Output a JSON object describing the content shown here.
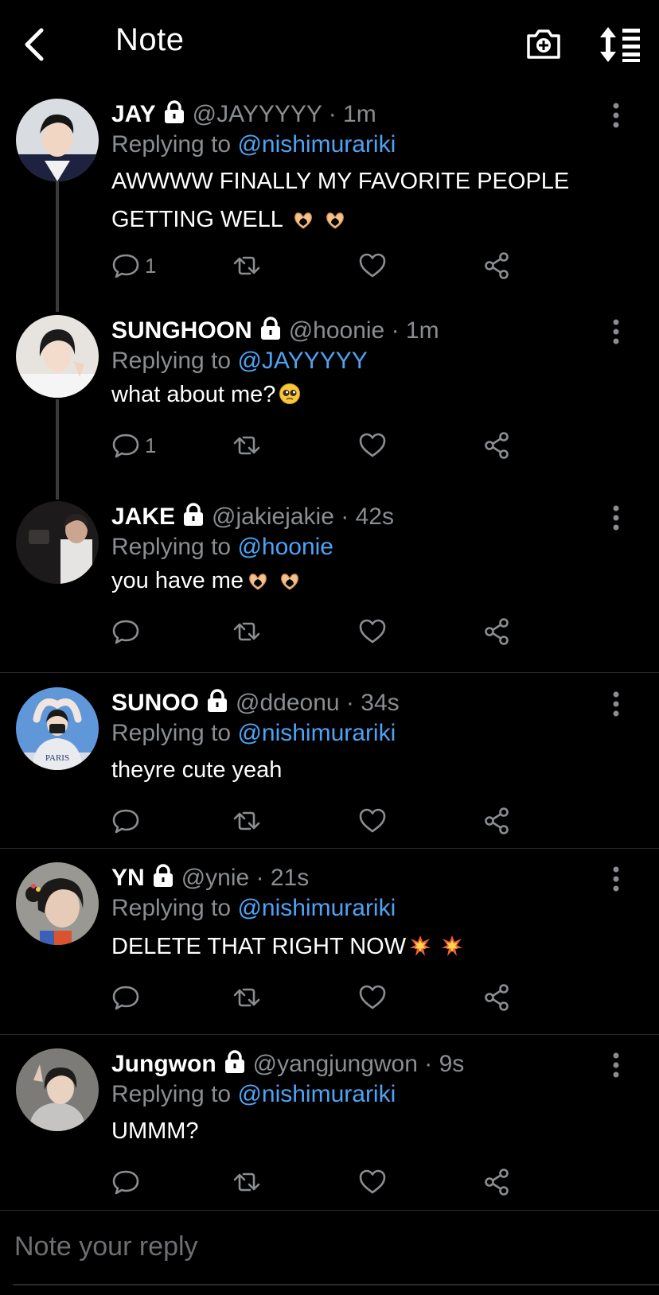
{
  "header": {
    "title": "Note",
    "back_icon": "chevron-left-icon",
    "camera_icon": "camera-plus-icon",
    "sort_icon": "sort-list-icon"
  },
  "colors": {
    "background": "#000000",
    "mention": "#4ea3f5",
    "muted": "#8a8d91"
  },
  "posts": [
    {
      "name": "JAY",
      "handle": "@JAYYYYY",
      "dot": "·",
      "time": "1m",
      "replying_label": "Replying to",
      "replying_to": "@nishimurariki",
      "text_lines": [
        "AWWWW FINALLY MY FAVORITE PEOPLE",
        "GETTING WELL"
      ],
      "reply_count": "1",
      "emoji": "heart-hands"
    },
    {
      "name": "SUNGHOON",
      "handle": "@hoonie",
      "dot": "·",
      "time": "1m",
      "replying_label": "Replying to",
      "replying_to": "@JAYYYYY",
      "text": "what about me?",
      "reply_count": "1",
      "emoji": "pleading-face"
    },
    {
      "name": "JAKE",
      "handle": "@jakiejakie",
      "dot": "·",
      "time": "42s",
      "replying_label": "Replying to",
      "replying_to": "@hoonie",
      "text": "you have me",
      "reply_count": "",
      "emoji": "heart-hands"
    },
    {
      "name": "SUNOO",
      "handle": "@ddeonu",
      "dot": "·",
      "time": "34s",
      "replying_label": "Replying to",
      "replying_to": "@nishimurariki",
      "text": "theyre cute yeah",
      "reply_count": ""
    },
    {
      "name": "YN",
      "handle": "@ynie",
      "dot": "·",
      "time": "21s",
      "replying_label": "Replying to",
      "replying_to": "@nishimurariki",
      "text": "DELETE THAT RIGHT NOW",
      "reply_count": "",
      "emoji": "collision"
    },
    {
      "name": "Jungwon",
      "handle": "@yangjungwon",
      "dot": "·",
      "time": "9s",
      "replying_label": "Replying to",
      "replying_to": "@nishimurariki",
      "text": "UMMM?",
      "reply_count": ""
    }
  ],
  "reply_box": {
    "placeholder": "Note your reply"
  }
}
